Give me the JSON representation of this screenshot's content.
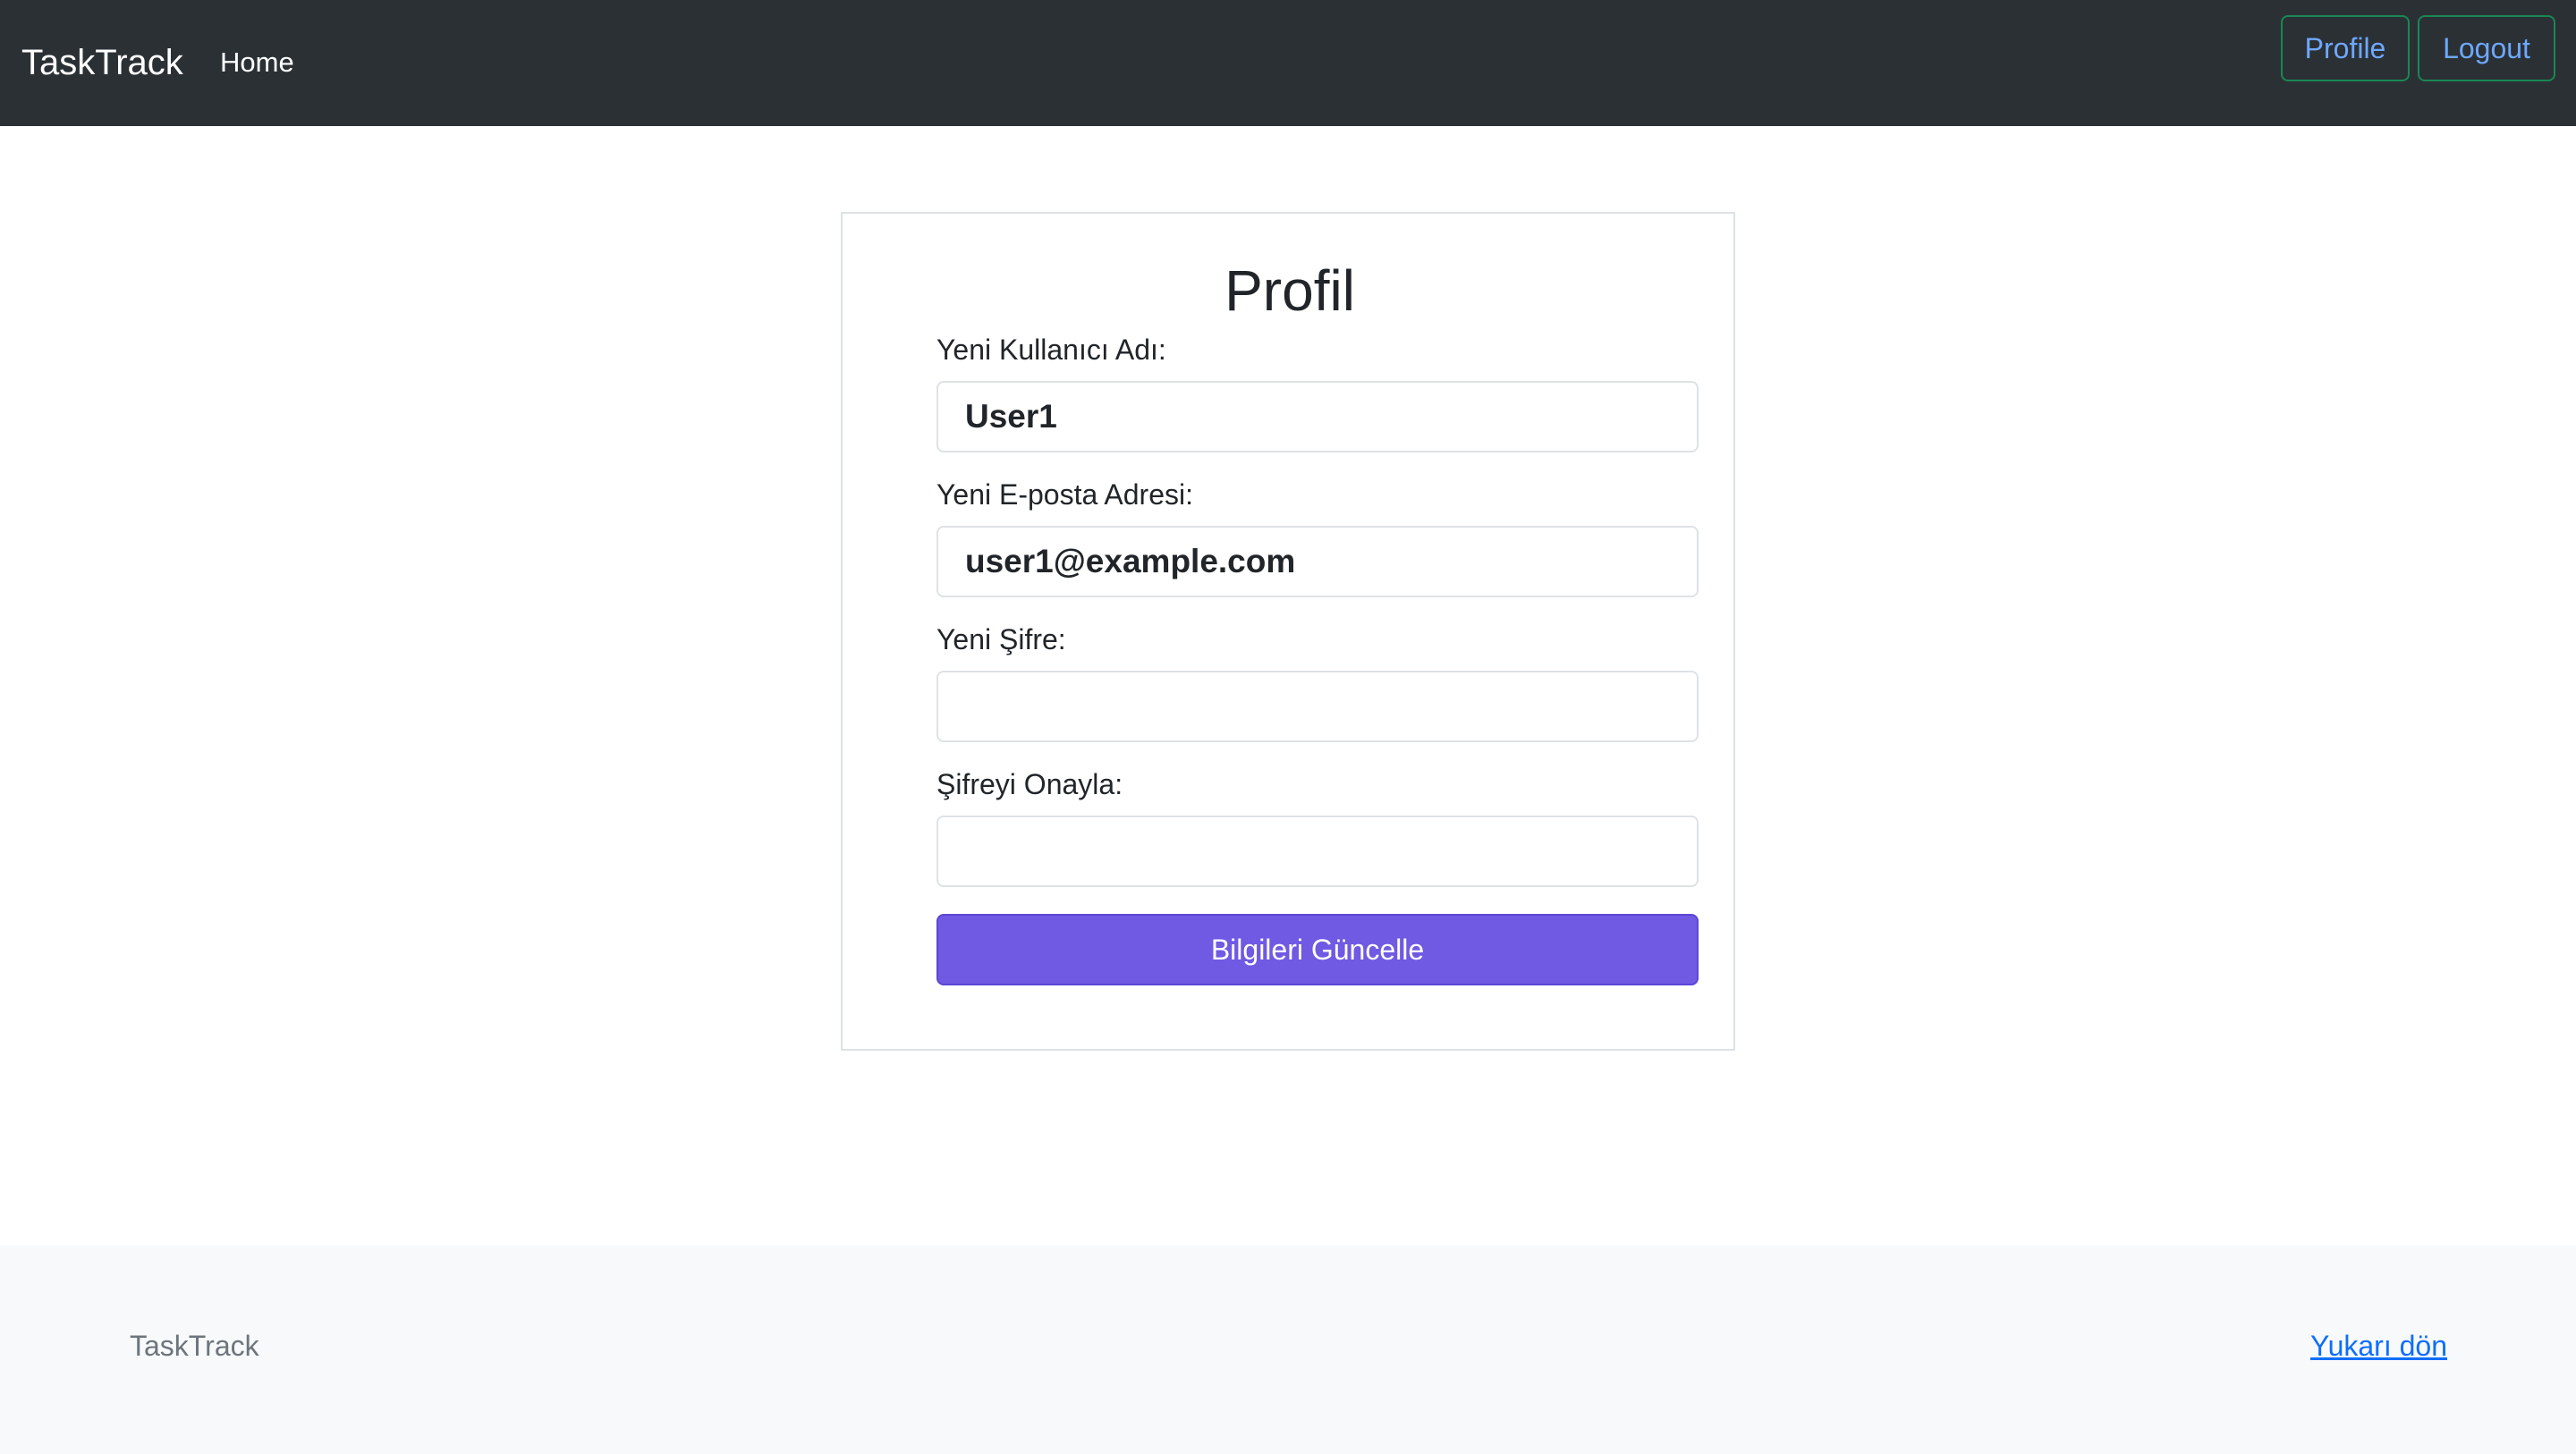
{
  "navbar": {
    "brand": "TaskTrack",
    "home_label": "Home",
    "profile_label": "Profile",
    "logout_label": "Logout"
  },
  "profile_form": {
    "title": "Profil",
    "username_label": "Yeni Kullanıcı Adı:",
    "username_value": "User1",
    "email_label": "Yeni E-posta Adresi:",
    "email_value": "user1@example.com",
    "password_label": "Yeni Şifre:",
    "password_value": "",
    "confirm_label": "Şifreyi Onayla:",
    "confirm_value": "",
    "submit_label": "Bilgileri Güncelle"
  },
  "footer": {
    "brand": "TaskTrack",
    "back_to_top": "Yukarı dön"
  },
  "colors": {
    "navbar_bg": "#2b3035",
    "accent_button": "#7059e3",
    "outline_border": "#198754",
    "link": "#0d6efd"
  }
}
